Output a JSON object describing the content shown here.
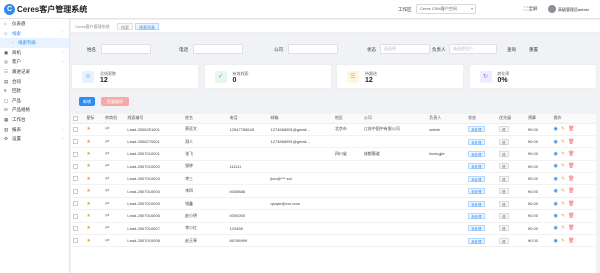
{
  "app": {
    "logo_char": "C",
    "title": "Ceres客户管理系统"
  },
  "header": {
    "workspace_label": "工作区",
    "workspace_value": "Ceres CRM客户空间",
    "fullscreen": "全屏",
    "user_name": "高级管理员admin",
    "caret": "▾"
  },
  "sidebar": {
    "items": [
      {
        "icon": "⌂",
        "label": "仪表盘",
        "chevron": ""
      },
      {
        "icon": "◇",
        "label": "线索",
        "chevron": "⌃"
      },
      {
        "icon": "◦",
        "label": "线索列表",
        "chevron": ""
      },
      {
        "icon": "▣",
        "label": "商机",
        "chevron": "⌄"
      },
      {
        "icon": "◎",
        "label": "客户",
        "chevron": "⌄"
      },
      {
        "icon": "☷",
        "label": "跟进记录",
        "chevron": ""
      },
      {
        "icon": "▤",
        "label": "合同",
        "chevron": ""
      },
      {
        "icon": "¥",
        "label": "回款",
        "chevron": ""
      },
      {
        "icon": "▢",
        "label": "产品",
        "chevron": ""
      },
      {
        "icon": "✉",
        "label": "产品规格",
        "chevron": ""
      },
      {
        "icon": "▦",
        "label": "工作台",
        "chevron": ""
      },
      {
        "icon": "▥",
        "label": "报表",
        "chevron": "⌄"
      },
      {
        "icon": "⚙",
        "label": "设置",
        "chevron": "⌄"
      }
    ]
  },
  "breadcrumb": {
    "home": "Ceres客户管理系统",
    "tab1": "线索",
    "tab2": "线索列表"
  },
  "filters": [
    {
      "label": "姓名",
      "placeholder": ""
    },
    {
      "label": "电话",
      "placeholder": ""
    },
    {
      "label": "公司",
      "placeholder": ""
    },
    {
      "label": "状态",
      "placeholder": "请选择"
    },
    {
      "label": "负责人",
      "placeholder": "请选择用户"
    },
    {
      "label": "查询",
      "placeholder": ""
    },
    {
      "label": "重置",
      "placeholder": ""
    }
  ],
  "stats": [
    {
      "icon": "☺",
      "label": "总线索数",
      "value": "12",
      "bg": "#e8f1ff",
      "fg": "#2d8cf0"
    },
    {
      "icon": "✓",
      "label": "有效线索",
      "value": "0",
      "bg": "#e6f7ef",
      "fg": "#19be6b"
    },
    {
      "icon": "☰",
      "label": "待跟进",
      "value": "12",
      "bg": "#fff6e0",
      "fg": "#e6a23c"
    },
    {
      "icon": "↻",
      "label": "转化率",
      "value": "0%",
      "bg": "#f1ebff",
      "fg": "#8e6ae6"
    }
  ],
  "toolbar": {
    "add": "新增",
    "delete": "批量删除"
  },
  "table": {
    "headers": [
      "",
      "星标",
      "转商机",
      "线索编号",
      "姓名",
      "电话",
      "邮箱",
      "地区",
      "公司",
      "负责人",
      "状态",
      "优先级",
      "预算",
      "操作"
    ],
    "rows": [
      {
        "code": "Lead-2506251001",
        "name": "蔡亚文",
        "phone": "12547785648",
        "email": "1274968951@gmail...",
        "region": "北京市",
        "company": "江苏中国中有限公司",
        "owner": "admin",
        "status": "未处理",
        "priority": "低",
        "budget": "¥0.00"
      },
      {
        "code": "Lead-2506270001",
        "name": "测人",
        "phone": "",
        "email": "1274968951@gmail...",
        "region": "",
        "company": "",
        "owner": "",
        "status": "未处理",
        "priority": "低",
        "budget": "¥0.00"
      },
      {
        "code": "Lead-2507010001",
        "name": "张飞",
        "phone": "",
        "email": "",
        "region": "四川省",
        "company": "成都蜀道",
        "owner": "liuxingjie",
        "status": "未处理",
        "priority": "低",
        "budget": "¥0.00"
      },
      {
        "code": "Lead-2507010002",
        "name": "邹钟",
        "phone": "111111",
        "email": "",
        "region": "",
        "company": "",
        "owner": "",
        "status": "未处理",
        "priority": "低",
        "budget": "¥0.00"
      },
      {
        "code": "Lead-2507010003",
        "name": "李三",
        "phone": "",
        "email": "jiao@***.sol",
        "region": "",
        "company": "",
        "owner": "",
        "status": "未处理",
        "priority": "低",
        "budget": "¥0.00"
      },
      {
        "code": "Lead-2507010004",
        "name": "李四",
        "phone": "0008888",
        "email": "",
        "region": "",
        "company": "",
        "owner": "",
        "status": "未处理",
        "priority": "低",
        "budget": "¥0.00"
      },
      {
        "code": "Lead-2507010005",
        "name": "钱鑫",
        "phone": "",
        "email": "qiuqie@xxx.com",
        "region": "",
        "company": "",
        "owner": "",
        "status": "未处理",
        "priority": "低",
        "budget": "¥0.00"
      },
      {
        "code": "Lead-2507010006",
        "name": "赵小明",
        "phone": "0000000",
        "email": "",
        "region": "",
        "company": "",
        "owner": "",
        "status": "未处理",
        "priority": "低",
        "budget": "¥0.00"
      },
      {
        "code": "Lead-2507010007",
        "name": "李小红",
        "phone": "123456",
        "email": "",
        "region": "",
        "company": "",
        "owner": "",
        "status": "未处理",
        "priority": "低",
        "budget": "¥0.00"
      },
      {
        "code": "Lead-2507010008",
        "name": "赵玉琴",
        "phone": "66768999",
        "email": "",
        "region": "",
        "company": "",
        "owner": "",
        "status": "未处理",
        "priority": "低",
        "budget": "¥0.00"
      }
    ]
  },
  "colors": {
    "primary": "#2d8cf0",
    "danger_light": "#f7a8a8",
    "star": "#e6a23c"
  },
  "icons": {
    "star": "★",
    "link": "⇄",
    "view": "◉",
    "edit": "✎",
    "delete": "🗑"
  }
}
